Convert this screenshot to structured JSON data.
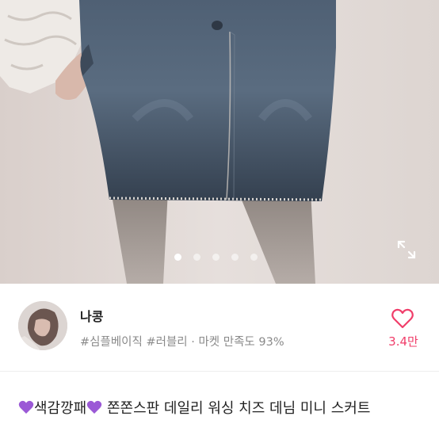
{
  "product_image": {
    "pager": {
      "count": 6,
      "active_index": 0
    },
    "expand_icon": "expand-icon"
  },
  "seller": {
    "name": "나콩",
    "tags_text": "#심플베이직 #러블리 · 마켓 만족도 93%",
    "like_count": "3.4만",
    "like_icon": "heart-outline-icon",
    "accent_color": "#f03e6a"
  },
  "product": {
    "emoji_icon": "purple-heart-icon",
    "emoji_color": "#9b59d6",
    "title_part1": "색감깡패",
    "title_part2": " 쫀쫀스판 데일리 워싱 치즈 데님 미니 스커트"
  }
}
